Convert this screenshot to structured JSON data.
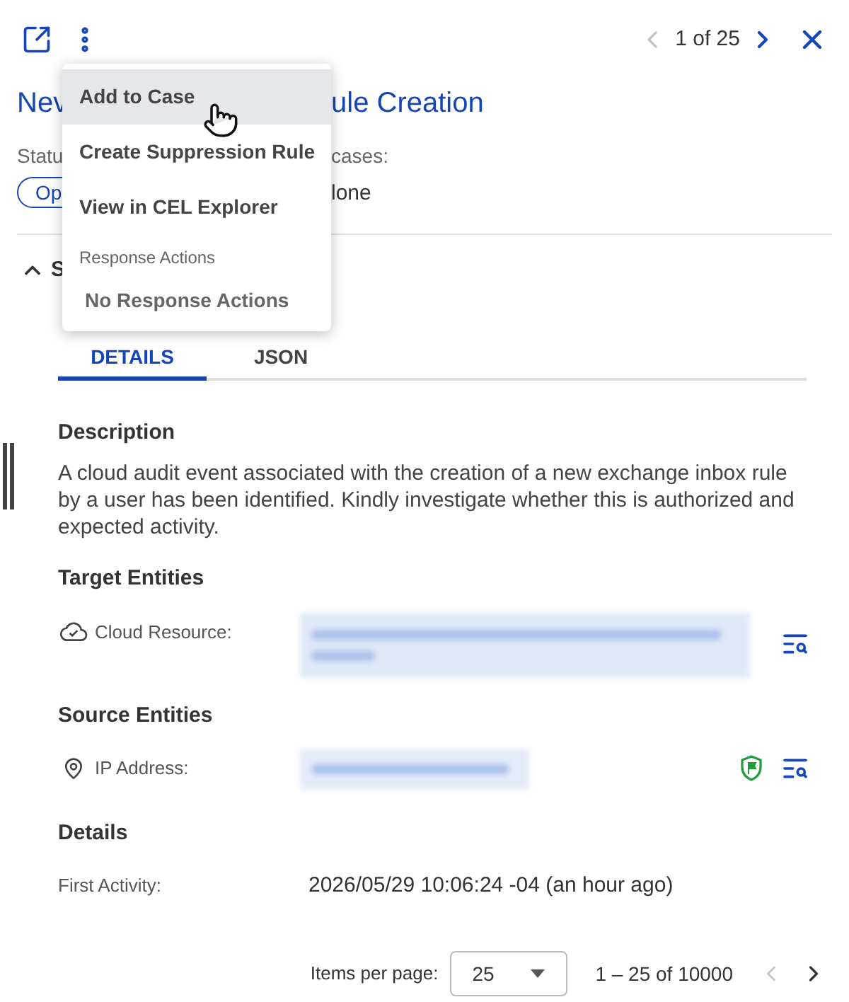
{
  "toolbar": {
    "pager": "1 of 25",
    "prev_disabled": true,
    "next_disabled": false
  },
  "title": {
    "visible_start": "Nev",
    "visible_end": "ule Creation"
  },
  "status": {
    "label_visible": "Statu",
    "badge_visible": "Op"
  },
  "cases": {
    "label_visible": "cases:",
    "value_visible": "lone"
  },
  "section": {
    "label_visible": "S",
    "expanded": true
  },
  "tabs": [
    {
      "label": "DETAILS",
      "selected": true
    },
    {
      "label": "JSON",
      "selected": false
    }
  ],
  "description": {
    "heading": "Description",
    "text": "A cloud audit event associated with the creation of a new exchange inbox rule by a user has been identified. Kindly investigate whether this is authorized and expected activity."
  },
  "target_entities": {
    "heading": "Target Entities",
    "rows": [
      {
        "kind": "cloud",
        "label": "Cloud Resource:",
        "flagged": false
      }
    ]
  },
  "source_entities": {
    "heading": "Source Entities",
    "rows": [
      {
        "kind": "ip",
        "label": "IP Address:",
        "flagged": true
      }
    ]
  },
  "details": {
    "heading": "Details",
    "rows": [
      {
        "label": "First Activity:",
        "value": "2026/05/29 10:06:24 -04 (an hour ago)"
      }
    ]
  },
  "footer": {
    "items_label": "Items per page:",
    "page_size": "25",
    "range": "1 – 25 of 10000",
    "prev_disabled": true,
    "next_disabled": false
  },
  "menu": {
    "items": [
      {
        "kind": "item",
        "label": "Add to Case",
        "highlighted": true
      },
      {
        "kind": "item",
        "label": "Create Suppression Rule",
        "highlighted": false
      },
      {
        "kind": "item",
        "label": "View in CEL Explorer",
        "highlighted": false
      },
      {
        "kind": "header",
        "label": "Response Actions"
      },
      {
        "kind": "disabled",
        "label": "No Response Actions"
      }
    ]
  }
}
